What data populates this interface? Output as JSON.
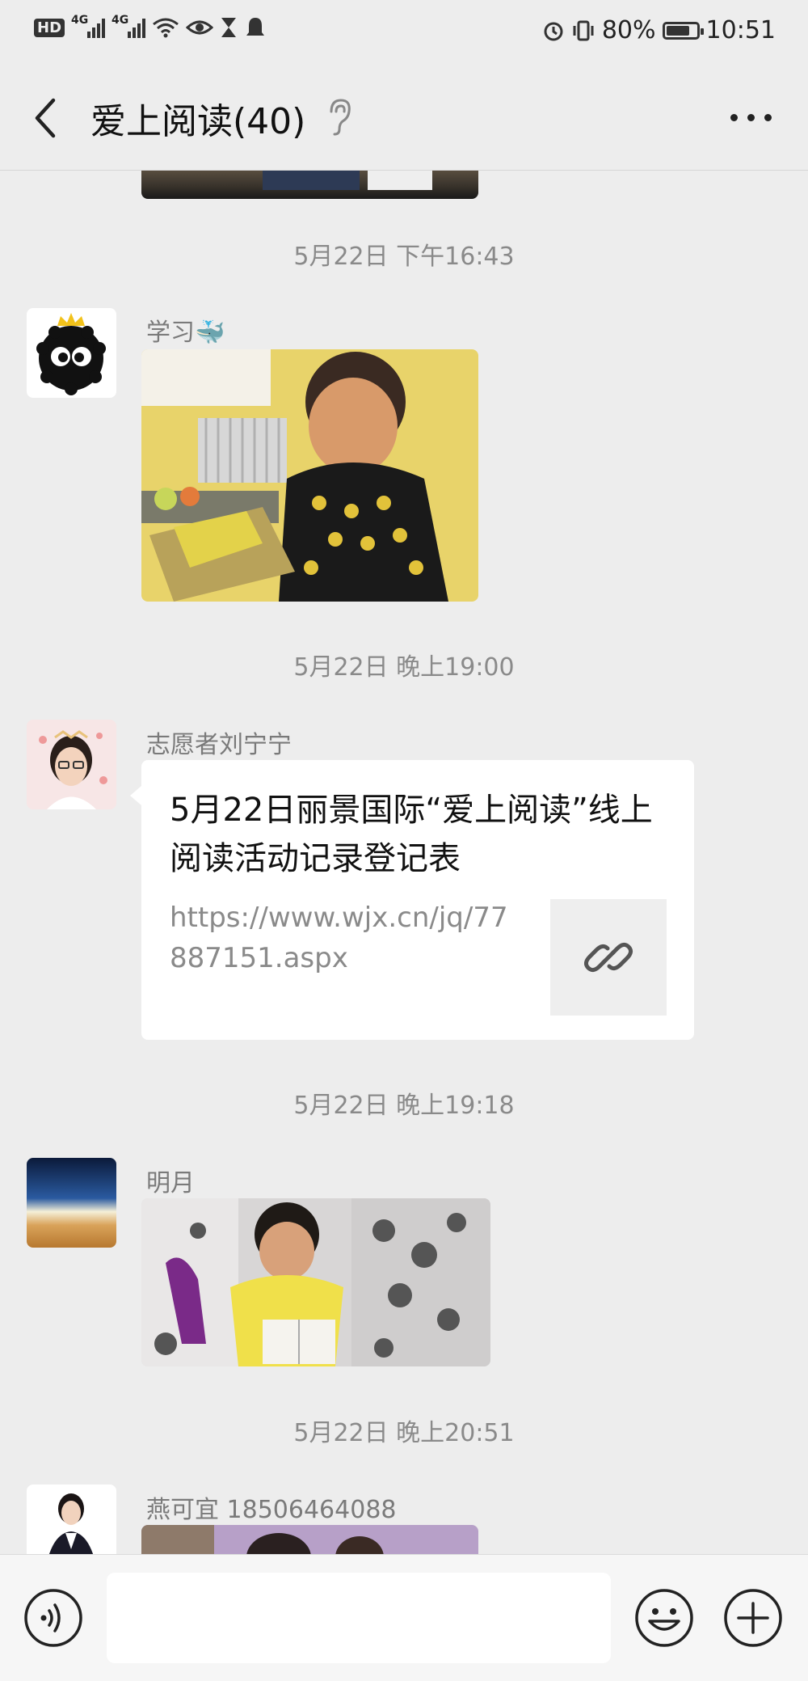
{
  "status_bar": {
    "hd": "HD",
    "sim1": "4G",
    "sim2": "4G",
    "battery_percent": "80%",
    "battery_level": 0.8,
    "time": "10:51"
  },
  "header": {
    "title": "爱上阅读(40)",
    "icons": [
      "back-icon",
      "ear-icon",
      "more-icon"
    ]
  },
  "messages": [
    {
      "timestamp": "5月22日 下午16:43",
      "sender": "学习🐳",
      "type": "image",
      "avatar": "soot-sprite-avatar"
    },
    {
      "timestamp": "5月22日 晚上19:00",
      "sender": "志愿者刘宁宁",
      "type": "link",
      "avatar": "woman-avatar",
      "link_title": "5月22日丽景国际“爱上阅读”线上阅读活动记录登记表",
      "link_url": "https://www.wjx.cn/jq/77887151.aspx"
    },
    {
      "timestamp": "5月22日 晚上19:18",
      "sender": "明月",
      "type": "image",
      "avatar": "horizon-avatar"
    },
    {
      "timestamp": "5月22日 晚上20:51",
      "sender": "燕可宜 18506464088",
      "type": "image",
      "avatar": "portrait-avatar"
    }
  ],
  "input_bar": {
    "placeholder": "",
    "icons": [
      "voice-icon",
      "emoji-icon",
      "plus-icon"
    ]
  },
  "colors": {
    "background": "#ededed",
    "bubble": "#ffffff",
    "timestamp_text": "#8a8a8a"
  }
}
